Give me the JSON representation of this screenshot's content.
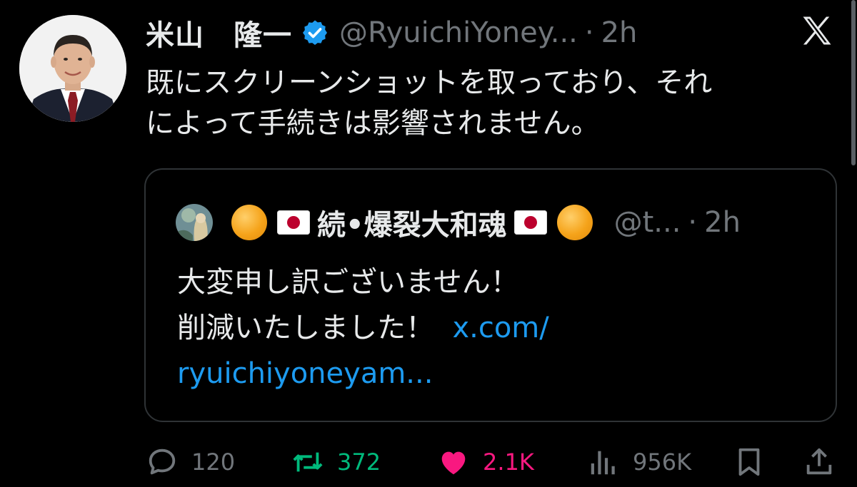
{
  "tweet": {
    "display_name": "米山　隆一",
    "handle": "@RyuichiYoney...",
    "separator": "·",
    "time": "2h",
    "text_lines": [
      "既にスクリーンショットを取っており、それ",
      "によって手続きは影響されません。"
    ]
  },
  "quote": {
    "name": "続•爆裂大和魂",
    "handle": "@t...",
    "separator": "·",
    "time": "2h",
    "text_lines": [
      "大変申し訳ございません！",
      "削減いたしました！"
    ],
    "link_line1": "x.com/",
    "link_line2": "ryuichiyoneyam..."
  },
  "actions": {
    "replies": "120",
    "reposts": "372",
    "likes": "2.1K",
    "views": "956K"
  },
  "colors": {
    "background": "#000000",
    "text": "#e7e9ea",
    "muted": "#71767b",
    "verified": "#1d9bf0",
    "link": "#1d9bf0",
    "repost": "#00ba7c",
    "like": "#f91880"
  },
  "icons": [
    "verified-badge-icon",
    "x-logo-icon",
    "reply-icon",
    "repost-icon",
    "like-icon",
    "views-icon",
    "bookmark-icon",
    "share-icon"
  ]
}
